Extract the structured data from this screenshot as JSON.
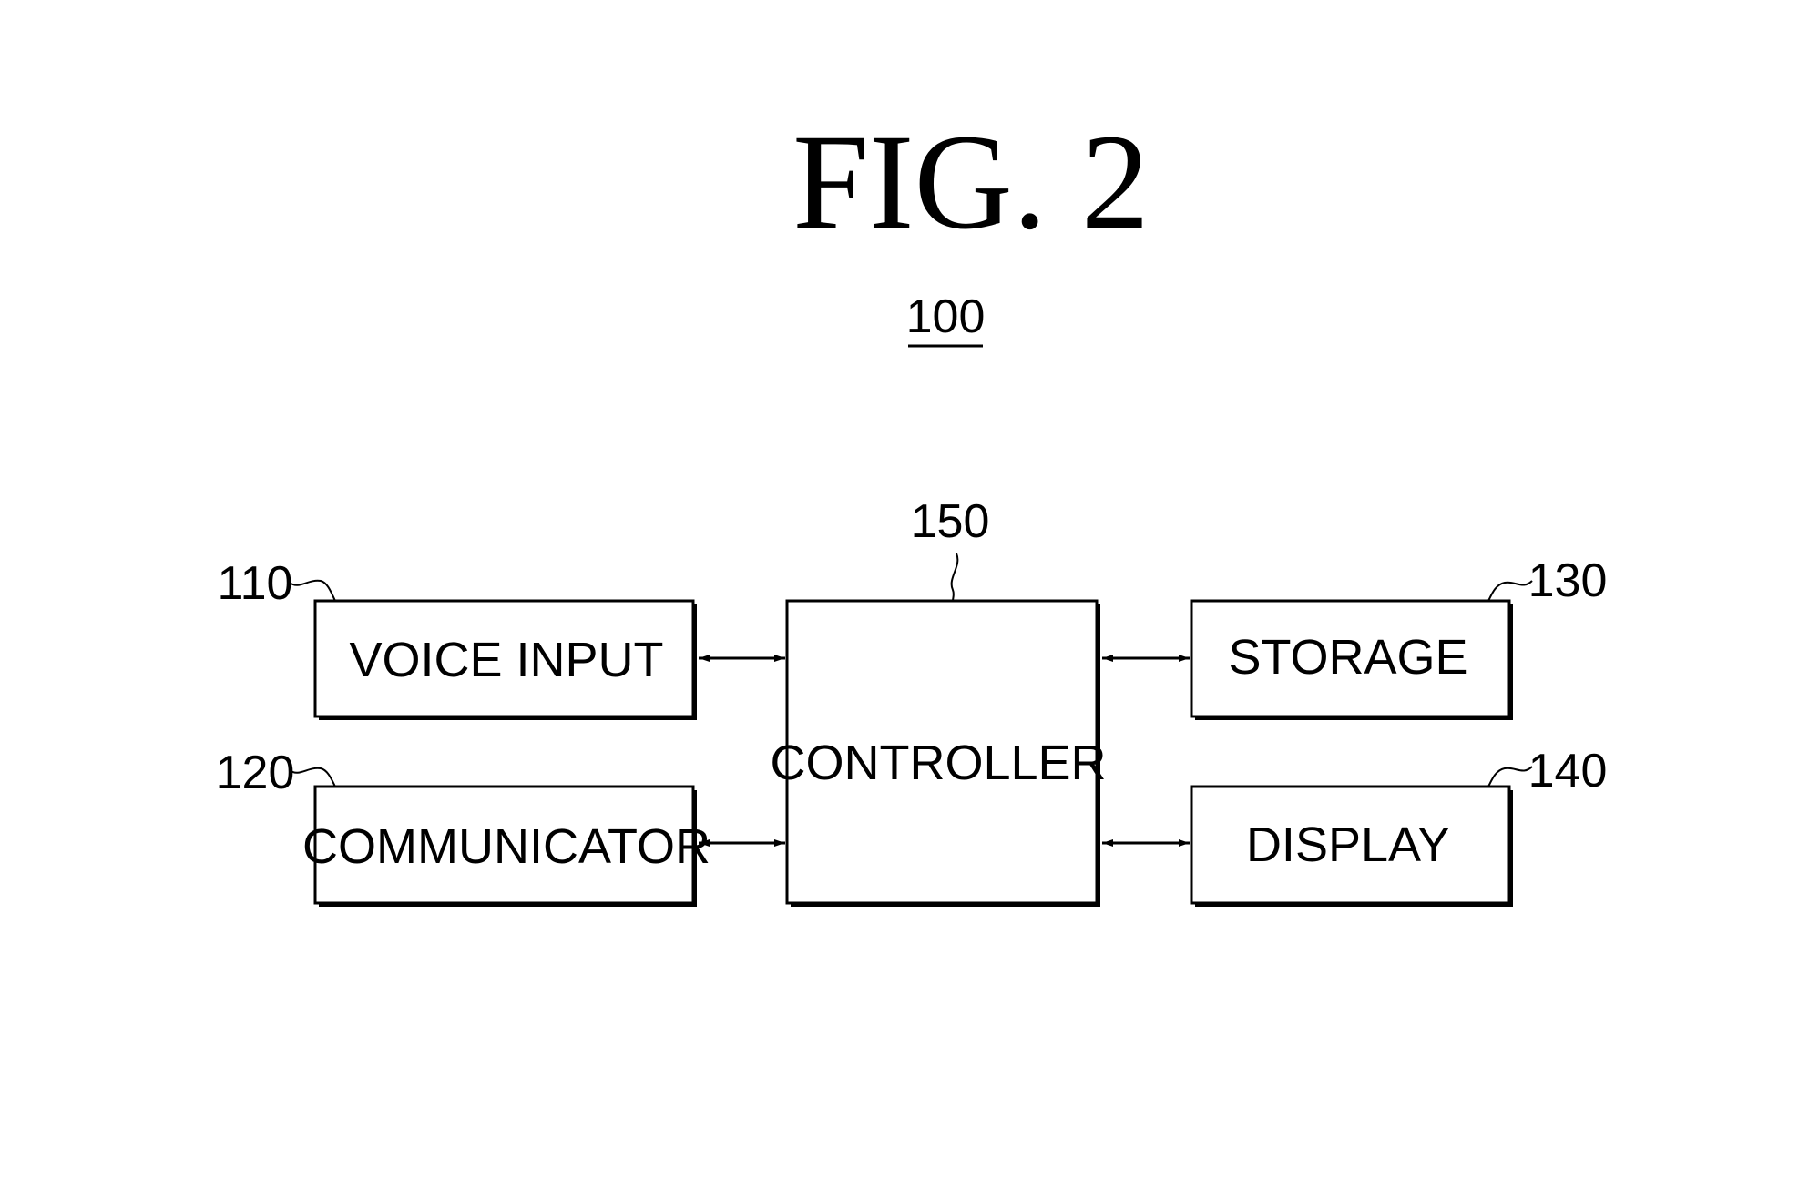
{
  "figure": {
    "title": "FIG. 2",
    "system_ref": "100"
  },
  "blocks": [
    {
      "id": "voice_input",
      "ref": "110",
      "label": "VOICE INPUT"
    },
    {
      "id": "communicator",
      "ref": "120",
      "label": "COMMUNICATOR"
    },
    {
      "id": "storage",
      "ref": "130",
      "label": "STORAGE"
    },
    {
      "id": "display",
      "ref": "140",
      "label": "DISPLAY"
    },
    {
      "id": "controller",
      "ref": "150",
      "label": "CONTROLLER"
    }
  ],
  "connections": [
    {
      "from": "voice_input",
      "to": "controller",
      "type": "bidirectional"
    },
    {
      "from": "communicator",
      "to": "controller",
      "type": "bidirectional"
    },
    {
      "from": "controller",
      "to": "storage",
      "type": "bidirectional"
    },
    {
      "from": "controller",
      "to": "display",
      "type": "bidirectional"
    }
  ]
}
